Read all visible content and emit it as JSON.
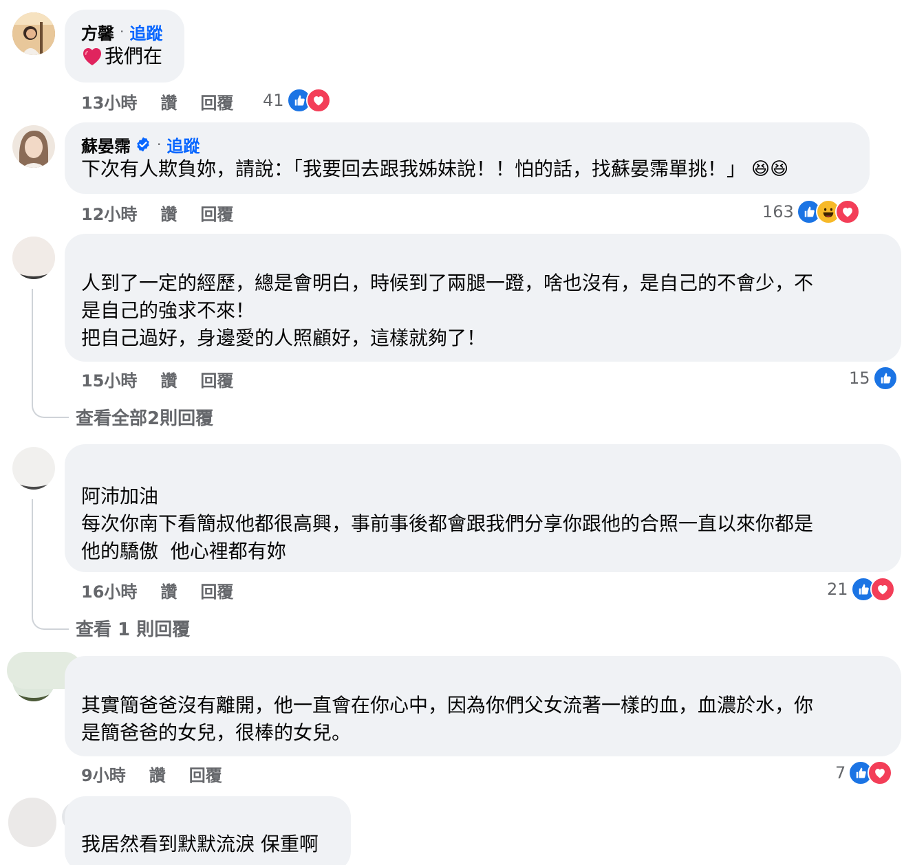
{
  "comments": [
    {
      "name": "方馨",
      "follow": "追蹤",
      "text": "我們在",
      "time": "13小時",
      "like": "讚",
      "reply": "回覆",
      "count": "41"
    },
    {
      "name": "蘇晏霈",
      "follow": "追蹤",
      "text": "下次有人欺負妳，請說：「我要回去跟我姊妹說！！怕的話，找蘇晏霈單挑！」",
      "emoji": "😆😆",
      "time": "12小時",
      "like": "讚",
      "reply": "回覆",
      "count": "163"
    },
    {
      "lines": [
        "人到了一定的經歷，總是會明白，時候到了兩腿一蹬，啥也沒有，是自己的不會少，不",
        "是自己的強求不來！",
        "把自己過好，身邊愛的人照顧好，這樣就夠了！"
      ],
      "time": "15小時",
      "like": "讚",
      "reply": "回覆",
      "count": "15",
      "view_replies": "查看全部2則回覆"
    },
    {
      "lines": [
        "阿沛加油",
        "每次你南下看簡叔他都很高興，事前事後都會跟我們分享你跟他的合照一直以來你都是",
        "他的驕傲  他心裡都有妳"
      ],
      "time": "16小時",
      "like": "讚",
      "reply": "回覆",
      "count": "21",
      "view_replies": "查看 1 則回覆"
    },
    {
      "lines": [
        "其實簡爸爸沒有離開，他一直會在你心中，因為你們父女流著一樣的血，血濃於水，你",
        "是簡爸爸的女兒，很棒的女兒。"
      ],
      "time": "9小時",
      "like": "讚",
      "reply": "回覆",
      "count": "7"
    },
    {
      "lines": [
        "我居然看到默默流淚 保重啊"
      ]
    }
  ],
  "icons": {
    "like": "like-reaction-icon",
    "love": "love-reaction-icon",
    "haha": "haha-reaction-icon",
    "heart": "red-heart-emoji",
    "verified": "verified-badge-icon"
  },
  "colors": {
    "bubble": "#f0f2f5",
    "follow": "#0866ff",
    "meta": "#65676b",
    "like": "#1b74e4",
    "love": "#f33e58",
    "haha": "#f7b928"
  }
}
